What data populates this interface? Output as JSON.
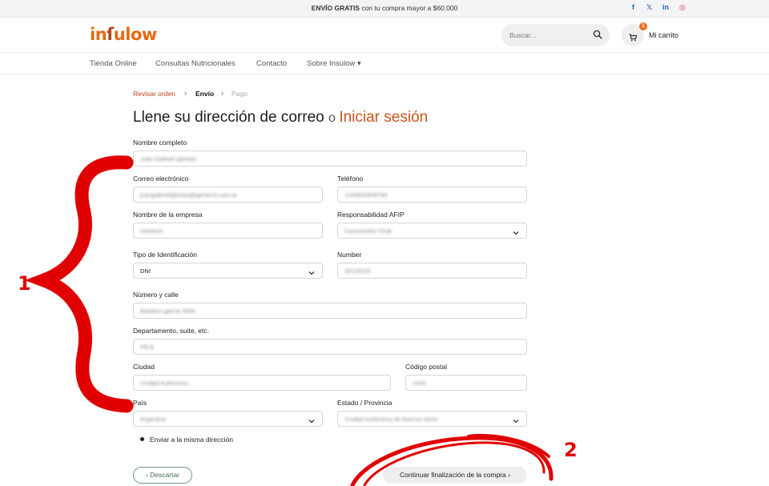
{
  "topbar": {
    "promo_bold": "ENVÍO GRATIS",
    "promo_text": " con tu compra mayor a $60.000",
    "social": [
      {
        "icon": "facebook-icon",
        "glyph": "f"
      },
      {
        "icon": "x-icon",
        "glyph": "𝕏"
      },
      {
        "icon": "linkedin-icon",
        "glyph": "in"
      },
      {
        "icon": "instagram-icon",
        "glyph": "◎"
      }
    ]
  },
  "header": {
    "logo_a": "in",
    "logo_b": "ſ",
    "logo_c": "ulow",
    "search_placeholder": "Buscar...",
    "cart_count": "1",
    "cart_label": "Mi carrito"
  },
  "nav": {
    "items": [
      "Tienda Online",
      "Consultas Nutricionales",
      "Contacto",
      "Sobre Insulow ▾"
    ]
  },
  "breadcrumb": {
    "step1": "Revisar orden",
    "step2": "Envío",
    "step3": "Pago",
    "sep": "›"
  },
  "title": {
    "text": "Llene su dirección de correo ",
    "or": "o ",
    "link": "Iniciar sesión"
  },
  "form": {
    "nombre": {
      "label": "Nombre completo",
      "value": "Juan Gabriel Iglesias"
    },
    "correo": {
      "label": "Correo electrónico",
      "value": "juangabrieliglesias@gentech.com.ar"
    },
    "telefono": {
      "label": "Teléfono",
      "value": "1154933408784"
    },
    "empresa": {
      "label": "Nombre de la empresa",
      "value": "Gentech"
    },
    "afip": {
      "label": "Responsabilidad AFIP",
      "value": "Consumidor Final"
    },
    "tipo_id": {
      "label": "Tipo de Identificación",
      "value": "DNI"
    },
    "number": {
      "label": "Number",
      "value": "30118225"
    },
    "calle": {
      "label": "Número y calle",
      "value": "Bastiero garcia 3490"
    },
    "depto": {
      "label": "Departamento, suite, etc.",
      "value": "PB B"
    },
    "ciudad": {
      "label": "Ciudad",
      "value": "Ciudad Autónoma"
    },
    "cp": {
      "label": "Código postal",
      "value": "1426"
    },
    "pais": {
      "label": "País",
      "value": "Argentina"
    },
    "provincia": {
      "label": "Estado / Provincia",
      "value": "Ciudad Autónoma de Buenos Aires"
    },
    "misma_direccion": "Enviar a la misma dirección"
  },
  "buttons": {
    "discard": "‹  Descartar",
    "continue": "Continuar finalización de la compra  ›"
  },
  "annotations": {
    "one": "1",
    "two": "2",
    "color": "#e00000"
  },
  "colors": {
    "accent": "#c9541e",
    "logo": "#e46a14",
    "badge": "#ee6d1a"
  }
}
